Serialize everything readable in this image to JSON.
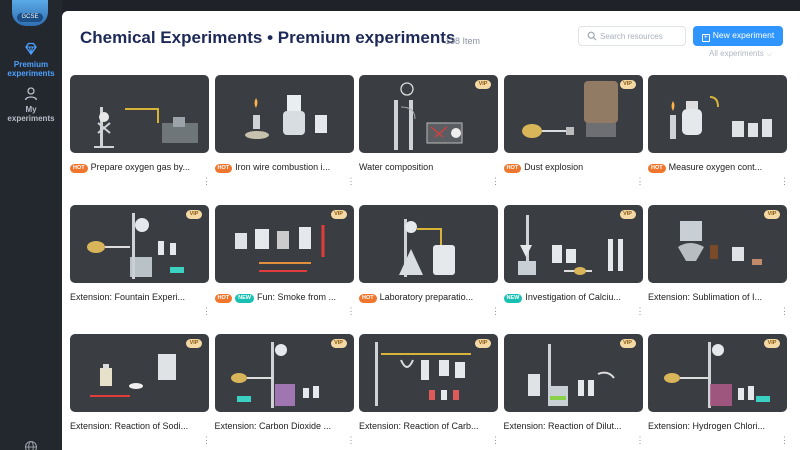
{
  "sidebar": {
    "logo_label": "GCSE",
    "items": [
      {
        "label_line1": "Premium",
        "label_line2": "experiments",
        "icon": "diamond-icon",
        "active": true
      },
      {
        "label_line1": "My",
        "label_line2": "experiments",
        "icon": "user-icon",
        "active": false
      }
    ],
    "bottom_icon": "globe-icon"
  },
  "header": {
    "title": "Chemical Experiments • Premium experiments",
    "count": "138 Item",
    "search_placeholder": "Search resources",
    "new_button": "New experiment",
    "filter": "All experiments"
  },
  "colors": {
    "accent": "#2f95ff",
    "title": "#1d2a57",
    "hot": "#f0762e",
    "new": "#18c0b3",
    "vip_bg": "#f4d9a4",
    "thumb_bg": "#3a3d42"
  },
  "cards": [
    {
      "title": "Prepare oxygen gas by...",
      "hot": true,
      "new": false,
      "vip": false
    },
    {
      "title": "Iron wire combustion i...",
      "hot": true,
      "new": false,
      "vip": false
    },
    {
      "title": "Water composition",
      "hot": false,
      "new": false,
      "vip": true
    },
    {
      "title": "Dust explosion",
      "hot": true,
      "new": false,
      "vip": true
    },
    {
      "title": "Measure oxygen cont...",
      "hot": true,
      "new": false,
      "vip": false
    },
    {
      "title": "Extension: Fountain Experi...",
      "hot": false,
      "new": false,
      "vip": true
    },
    {
      "title": "Fun: Smoke from ...",
      "hot": true,
      "new": true,
      "vip": true
    },
    {
      "title": "Laboratory preparatio...",
      "hot": true,
      "new": false,
      "vip": false
    },
    {
      "title": "Investigation of Calciu...",
      "hot": false,
      "new": true,
      "vip": true
    },
    {
      "title": "Extension: Sublimation of I...",
      "hot": false,
      "new": false,
      "vip": true
    },
    {
      "title": "Extension: Reaction of Sodi...",
      "hot": false,
      "new": false,
      "vip": true
    },
    {
      "title": "Extension: Carbon Dioxide ...",
      "hot": false,
      "new": false,
      "vip": true
    },
    {
      "title": "Extension: Reaction of Carb...",
      "hot": false,
      "new": false,
      "vip": true
    },
    {
      "title": "Extension: Reaction of Dilut...",
      "hot": false,
      "new": false,
      "vip": true
    },
    {
      "title": "Extension: Hydrogen Chlori...",
      "hot": false,
      "new": false,
      "vip": true
    }
  ],
  "labels": {
    "hot": "HOT",
    "new": "NEW",
    "vip": "VIP",
    "more": "⋮"
  }
}
